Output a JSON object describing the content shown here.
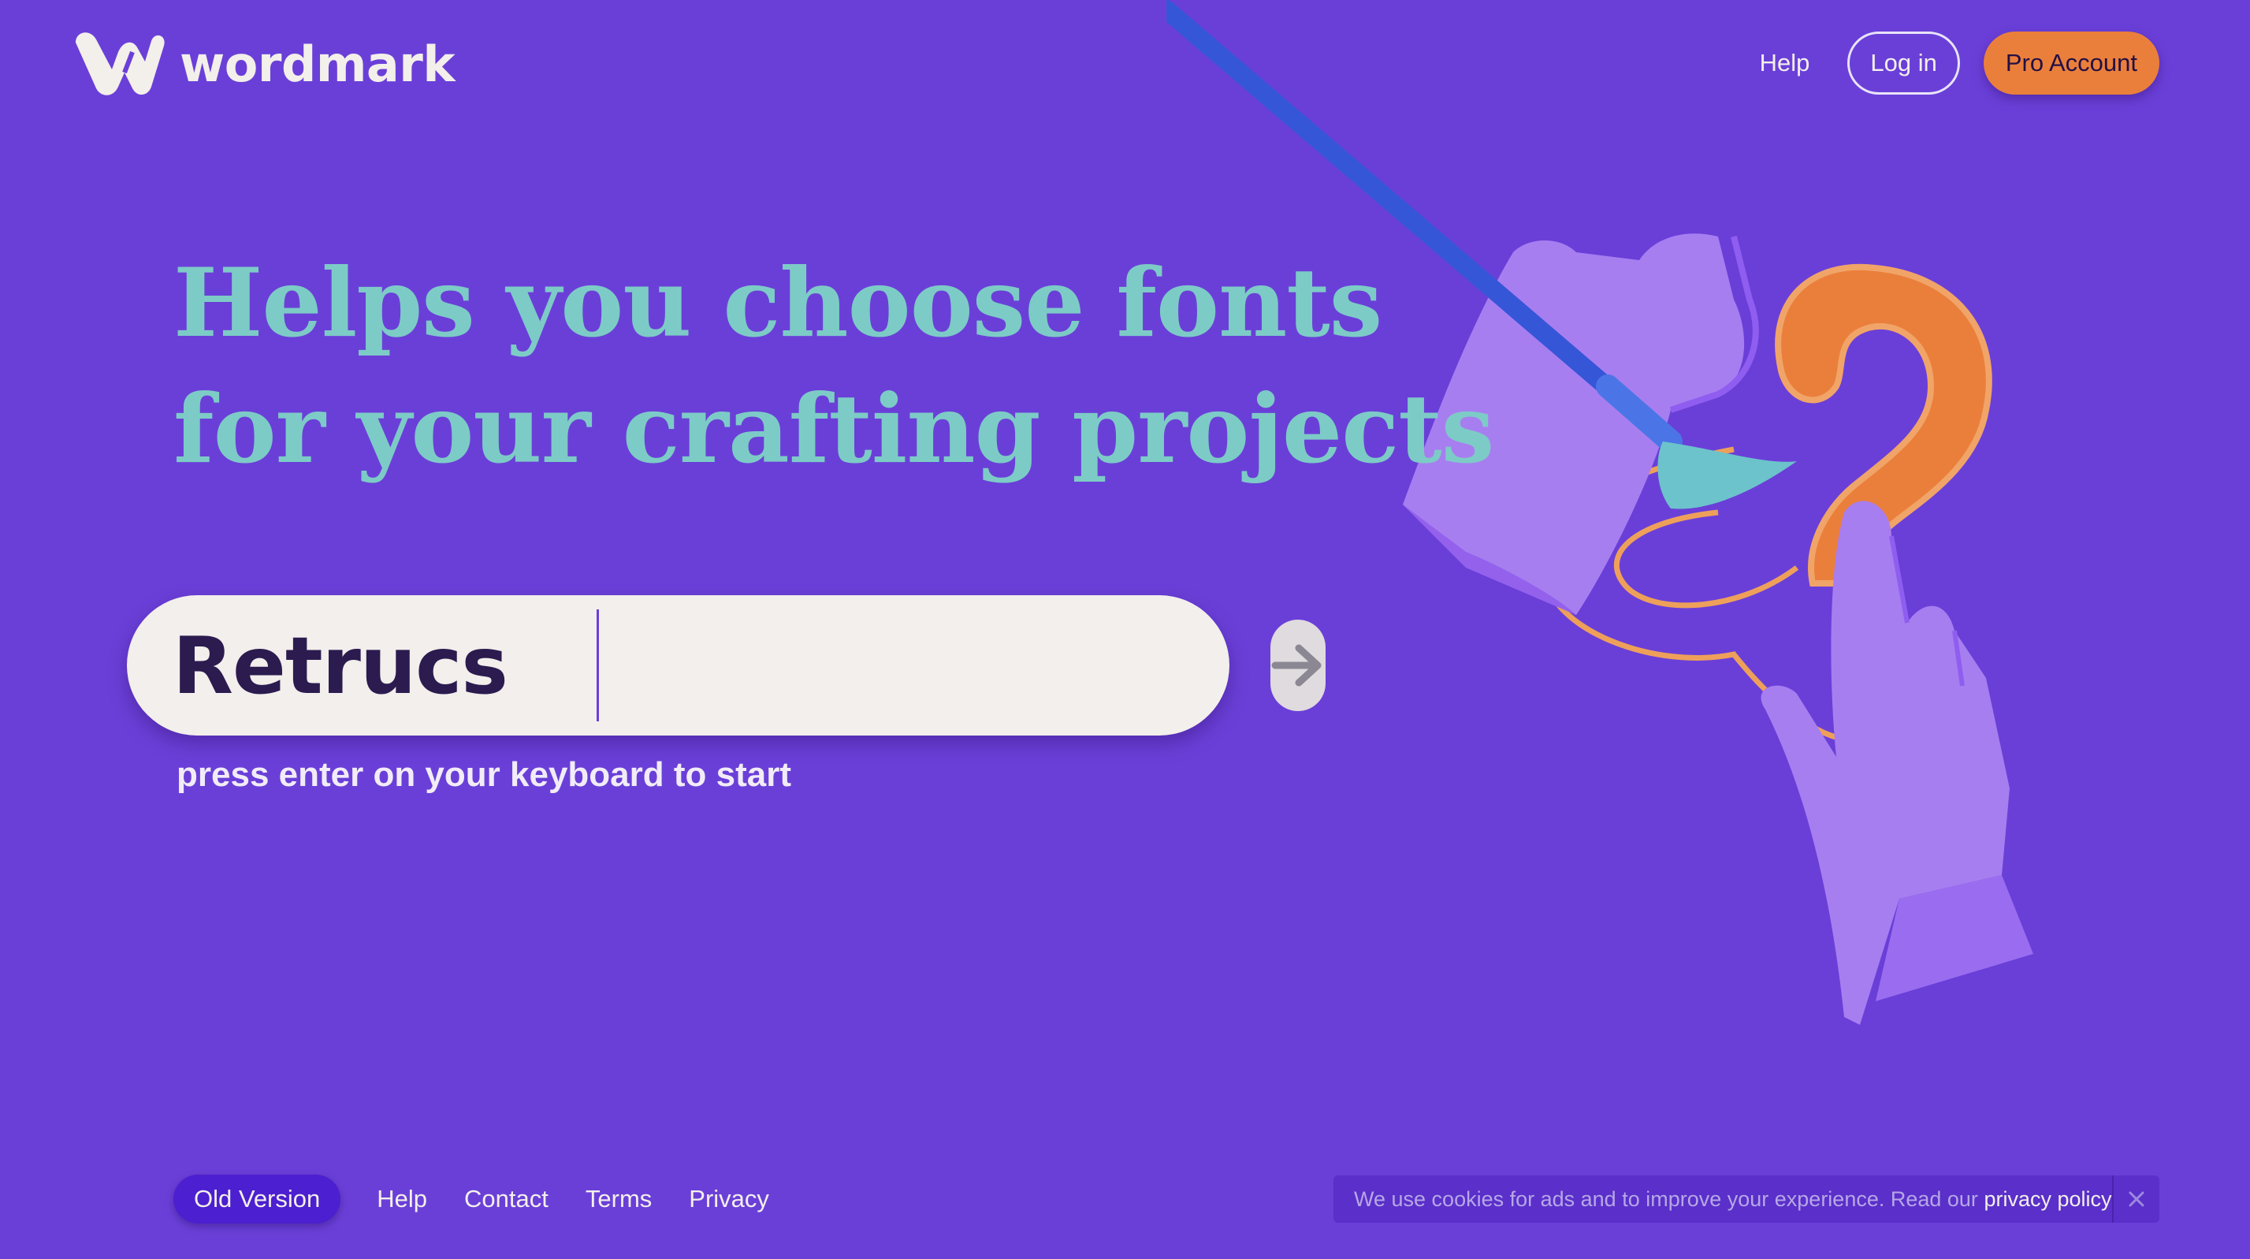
{
  "header": {
    "logo_text": "wordmark",
    "nav": {
      "help_label": "Help",
      "login_label": "Log in",
      "pro_label": "Pro Account"
    }
  },
  "hero": {
    "headline_line1": "Helps you choose fonts",
    "headline_line2": "for your crafting projects",
    "search_value": "Retrucs",
    "hint": "press enter on your keyboard to start"
  },
  "footer": {
    "old_version_label": "Old Version",
    "links": [
      "Help",
      "Contact",
      "Terms",
      "Privacy"
    ]
  },
  "cookie_banner": {
    "text": "We use cookies for ads and to improve your experience. Read our ",
    "link_label": "privacy policy",
    "close_icon": "close-icon"
  },
  "colors": {
    "background": "#6a3fd8",
    "headline": "#7dcbc6",
    "accent_orange": "#ea7f3c",
    "search_bg": "#f2efec"
  }
}
